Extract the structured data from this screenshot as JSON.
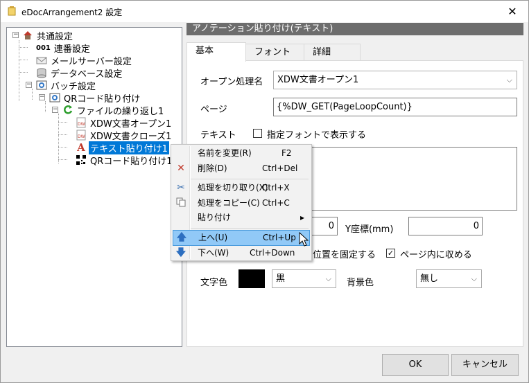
{
  "window": {
    "title": "eDocArrangement2 設定"
  },
  "tree": {
    "nodes": [
      {
        "label": "共通設定",
        "icon": "house-icon"
      },
      {
        "label": "連番設定",
        "icon": "sequence-number-icon",
        "prefix": "001"
      },
      {
        "label": "メールサーバー設定",
        "icon": "envelope-icon"
      },
      {
        "label": "データベース設定",
        "icon": "database-icon"
      },
      {
        "label": "バッチ設定",
        "icon": "batch-icon"
      },
      {
        "label": "QRコード貼り付け",
        "icon": "batch-icon"
      },
      {
        "label": "ファイルの繰り返し1",
        "icon": "loop-arrow-icon"
      },
      {
        "label": "XDW文書オープン1",
        "icon": "xdw-document-icon"
      },
      {
        "label": "XDW文書クローズ1",
        "icon": "xdw-document-icon"
      },
      {
        "label": "テキスト貼り付け1",
        "icon": "text-a-icon"
      },
      {
        "label": "QRコード貼り付け1",
        "icon": "qr-code-icon"
      }
    ]
  },
  "section": {
    "header": "アノテーション貼り付け(テキスト)"
  },
  "tabs": [
    "基本",
    "フォント",
    "詳細"
  ],
  "form": {
    "open_label": "オープン処理名",
    "open_value": "XDW文書オープン1",
    "page_label": "ページ",
    "page_value": "{%DW_GET(PageLoopCount)}",
    "text_label": "テキスト",
    "font_check_label": "指定フォントで表示する",
    "x_value": "0",
    "y_label": "Y座標(mm)",
    "y_value": "0",
    "fix_label": "位置を固定する",
    "fit_label": "ページ内に収める",
    "text_color_label": "文字色",
    "text_color_value": "黒",
    "bg_color_label": "背景色",
    "bg_color_value": "無し"
  },
  "buttons": {
    "ok": "OK",
    "cancel": "キャンセル"
  },
  "context_menu": {
    "items": [
      {
        "label": "名前を変更(R)",
        "shortcut": "F2"
      },
      {
        "label": "削除(D)",
        "shortcut": "Ctrl+Del",
        "icon": "delete-x-icon"
      },
      {
        "label": "処理を切り取り(X)",
        "shortcut": "Ctrl+X",
        "icon": "scissors-icon"
      },
      {
        "label": "処理をコピー(C)",
        "shortcut": "Ctrl+C",
        "icon": "copy-icon"
      },
      {
        "label": "貼り付け",
        "shortcut": "▸"
      },
      {
        "label": "上へ(U)",
        "shortcut": "Ctrl+Up",
        "icon": "arrow-up-icon"
      },
      {
        "label": "下へ(W)",
        "shortcut": "Ctrl+Down",
        "icon": "arrow-down-icon"
      }
    ]
  },
  "colors": {
    "selection": "#0078d7",
    "menu_highlight": "#91c9f7",
    "header": "#6d6d6d"
  }
}
